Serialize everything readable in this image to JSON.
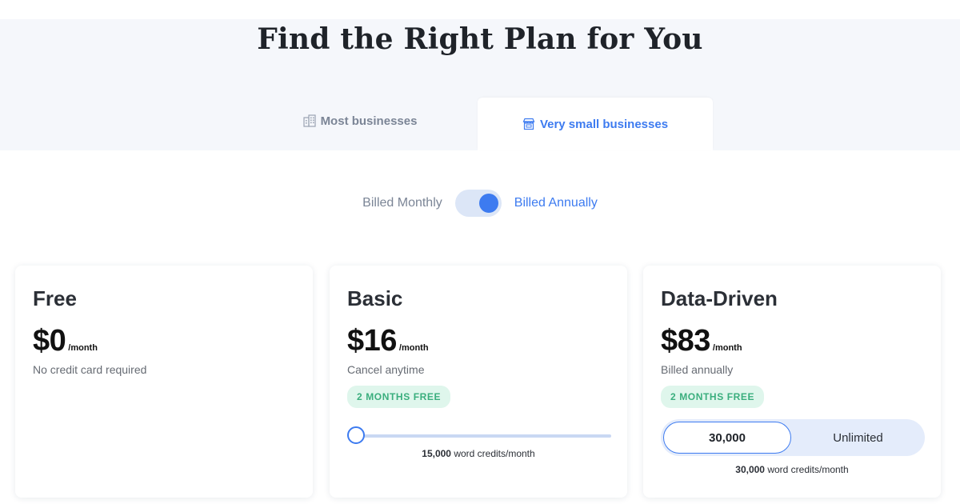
{
  "page": {
    "title": "Find the Right Plan for You"
  },
  "tabs": [
    {
      "label": "Most businesses",
      "icon": "building-icon",
      "active": false
    },
    {
      "label": "Very small businesses",
      "icon": "storefront-icon",
      "active": true
    }
  ],
  "billing": {
    "monthly_label": "Billed Monthly",
    "annual_label": "Billed Annually",
    "selected": "annual"
  },
  "plans": [
    {
      "name": "Free",
      "price": "$0",
      "period": "/month",
      "note": "No credit card required"
    },
    {
      "name": "Basic",
      "price": "$16",
      "period": "/month",
      "note": "Cancel anytime",
      "badge": "2 MONTHS FREE",
      "slider_level": 0,
      "credits_value": "15,000",
      "credits_suffix": " word credits/month"
    },
    {
      "name": "Data-Driven",
      "price": "$83",
      "period": "/month",
      "note": "Billed annually",
      "badge": "2 MONTHS FREE",
      "options": [
        "30,000",
        "Unlimited"
      ],
      "selected_option": "30,000",
      "credits_value": "30,000",
      "credits_suffix": " word credits/month"
    }
  ],
  "colors": {
    "accent": "#3d7bf0",
    "badge_bg": "#dff6ec",
    "badge_text": "#3aae7d",
    "band_bg": "#f5f7fb"
  }
}
